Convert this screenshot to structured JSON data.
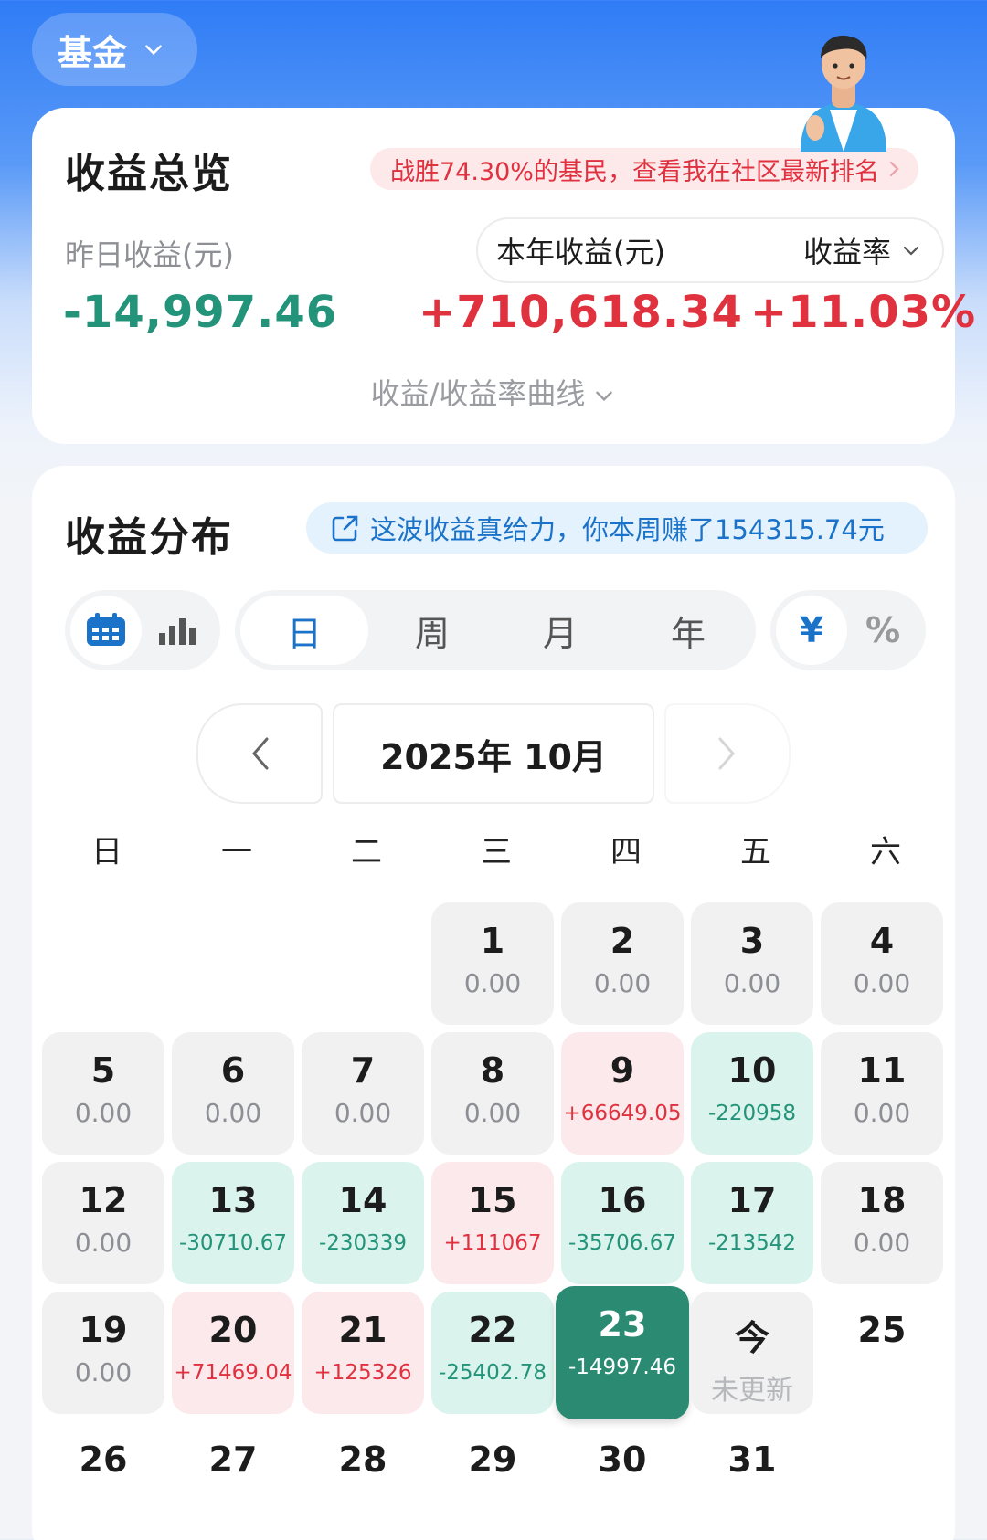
{
  "top_selector": {
    "label": "基金"
  },
  "overview": {
    "title": "收益总览",
    "rank_banner": "战胜74.30%的基民，查看我在社区最新排名",
    "yesterday_label": "昨日收益(元)",
    "yesterday_value": "-14,997.46",
    "year_label": "本年收益(元)",
    "rate_label": "收益率",
    "year_value": "+710,618.34",
    "rate_value": "+11.03%",
    "curve_toggle": "收益/收益率曲线"
  },
  "distribution": {
    "title": "收益分布",
    "week_banner": "这波收益真给力，你本周赚了154315.74元",
    "period_tabs": [
      "日",
      "周",
      "月",
      "年"
    ],
    "unit_tabs": [
      "¥",
      "%"
    ],
    "month_label": "2025年 10月",
    "weekdays": [
      "日",
      "一",
      "二",
      "三",
      "四",
      "五",
      "六"
    ]
  },
  "calendar": [
    {
      "day": "1",
      "value": "0.00",
      "kind": "neutral"
    },
    {
      "day": "2",
      "value": "0.00",
      "kind": "neutral"
    },
    {
      "day": "3",
      "value": "0.00",
      "kind": "neutral"
    },
    {
      "day": "4",
      "value": "0.00",
      "kind": "neutral"
    },
    {
      "day": "5",
      "value": "0.00",
      "kind": "neutral"
    },
    {
      "day": "6",
      "value": "0.00",
      "kind": "neutral"
    },
    {
      "day": "7",
      "value": "0.00",
      "kind": "neutral"
    },
    {
      "day": "8",
      "value": "0.00",
      "kind": "neutral"
    },
    {
      "day": "9",
      "value": "+66649.05",
      "kind": "up"
    },
    {
      "day": "10",
      "value": "-220958",
      "kind": "down"
    },
    {
      "day": "11",
      "value": "0.00",
      "kind": "neutral"
    },
    {
      "day": "12",
      "value": "0.00",
      "kind": "neutral"
    },
    {
      "day": "13",
      "value": "-30710.67",
      "kind": "down"
    },
    {
      "day": "14",
      "value": "-230339",
      "kind": "down"
    },
    {
      "day": "15",
      "value": "+111067",
      "kind": "up"
    },
    {
      "day": "16",
      "value": "-35706.67",
      "kind": "down"
    },
    {
      "day": "17",
      "value": "-213542",
      "kind": "down"
    },
    {
      "day": "18",
      "value": "0.00",
      "kind": "neutral"
    },
    {
      "day": "19",
      "value": "0.00",
      "kind": "neutral"
    },
    {
      "day": "20",
      "value": "+71469.04",
      "kind": "up"
    },
    {
      "day": "21",
      "value": "+125326",
      "kind": "up"
    },
    {
      "day": "22",
      "value": "-25402.78",
      "kind": "down"
    },
    {
      "day": "23",
      "value": "-14997.46",
      "kind": "selected"
    },
    {
      "day": "今",
      "value": "未更新",
      "kind": "today"
    },
    {
      "day": "25",
      "value": "",
      "kind": "plain"
    },
    {
      "day": "26",
      "value": "",
      "kind": "plain"
    },
    {
      "day": "27",
      "value": "",
      "kind": "plain"
    },
    {
      "day": "28",
      "value": "",
      "kind": "plain"
    },
    {
      "day": "29",
      "value": "",
      "kind": "plain"
    },
    {
      "day": "30",
      "value": "",
      "kind": "plain"
    },
    {
      "day": "31",
      "value": "",
      "kind": "plain"
    }
  ],
  "calendar_first_weekday": 3,
  "colors": {
    "brand_blue": "#2f7cf6",
    "gain_red": "#e0313f",
    "loss_green": "#23947a",
    "selected": "#2a8a72"
  },
  "icons": [
    "chevron-down-icon",
    "calendar-icon",
    "bar-chart-icon",
    "share-icon",
    "chevron-left-icon",
    "chevron-right-icon"
  ]
}
